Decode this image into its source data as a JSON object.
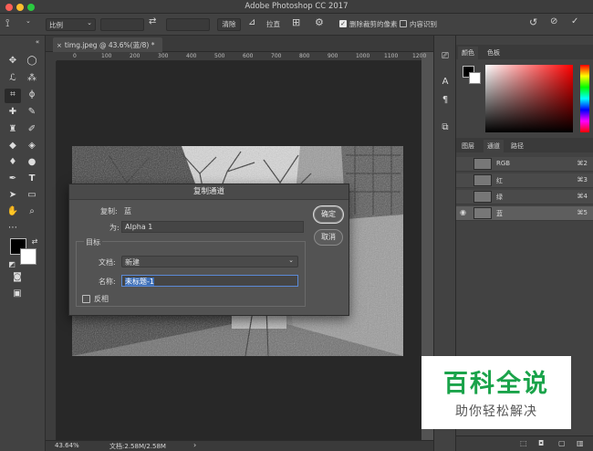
{
  "app_title": "Adobe Photoshop CC 2017",
  "options_bar": {
    "ratio_select": "比例",
    "clear_button": "清除",
    "straighten_button": "拉直",
    "delete_cropped_label": "删除裁剪的像素",
    "content_aware_label": "内容识别",
    "delete_cropped_checked": true,
    "content_aware_checked": false
  },
  "document_tab": "timg.jpeg @ 43.6%(蓝/8) *",
  "ruler_ticks": [
    "0",
    "100",
    "200",
    "300",
    "400",
    "500",
    "600",
    "700",
    "800",
    "900",
    "1000",
    "1100",
    "1200"
  ],
  "status": {
    "zoom": "43.64%",
    "doc_info": "文档:2.58M/2.58M"
  },
  "right_panel": {
    "color_tabs": [
      "颜色",
      "色板"
    ],
    "layer_tabs": [
      "图层",
      "通道",
      "路径"
    ],
    "active_layer_tab": "通道",
    "channels": [
      {
        "name": "RGB",
        "shortcut": "⌘2",
        "visible": false,
        "selected": false
      },
      {
        "name": "红",
        "shortcut": "⌘3",
        "visible": false,
        "selected": false
      },
      {
        "name": "绿",
        "shortcut": "⌘4",
        "visible": false,
        "selected": false
      },
      {
        "name": "蓝",
        "shortcut": "⌘5",
        "visible": true,
        "selected": true
      }
    ]
  },
  "dialog": {
    "title": "复制通道",
    "copy_label": "复制:",
    "copy_value": "蓝",
    "as_label": "为:",
    "as_value": "Alpha 1",
    "target_group": "目标",
    "doc_label": "文档:",
    "doc_value": "新建",
    "name_label": "名称:",
    "name_value": "未标题-1",
    "invert_label": "反相",
    "invert_checked": false,
    "ok_button": "确定",
    "cancel_button": "取消"
  },
  "watermark": {
    "line1": "百科全说",
    "line2": "助你轻松解决",
    "color": "#1aa34a"
  }
}
